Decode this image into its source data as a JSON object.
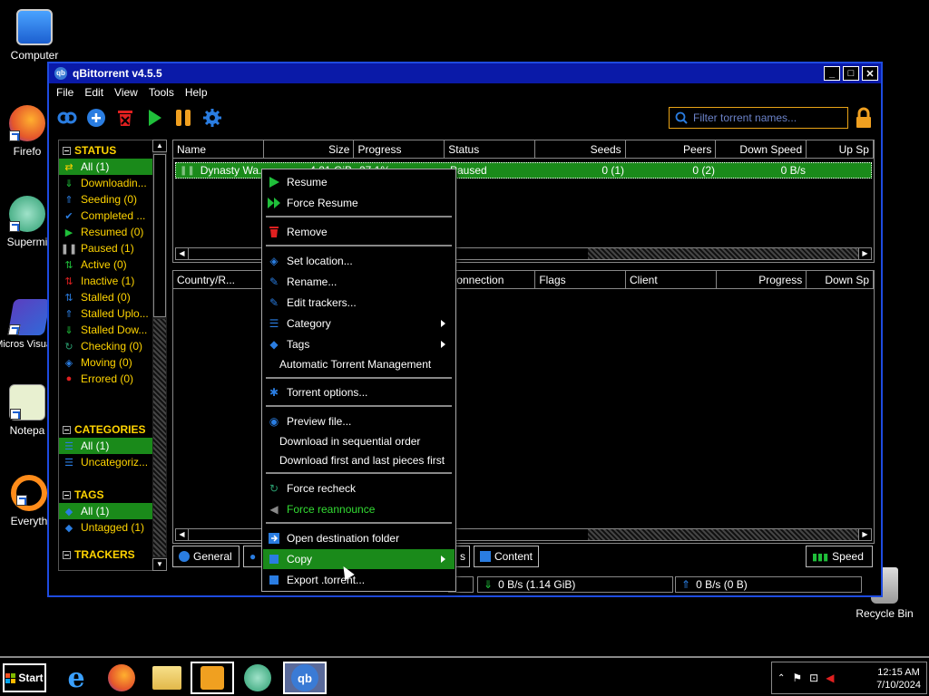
{
  "desktop": {
    "icons": [
      {
        "label": "Computer"
      },
      {
        "label": "Firefo"
      },
      {
        "label": "Supermi"
      },
      {
        "label": "Micros Visual S"
      },
      {
        "label": "Notepa"
      },
      {
        "label": "Everyth"
      },
      {
        "label": "Recycle Bin"
      }
    ]
  },
  "window": {
    "title": "qBittorrent v4.5.5",
    "controls": {
      "minimize": "_",
      "maximize": "□",
      "close": "✕"
    },
    "menu": [
      "File",
      "Edit",
      "View",
      "Tools",
      "Help"
    ],
    "search_placeholder": "Filter torrent names..."
  },
  "sidebar": {
    "status_header": "STATUS",
    "status_items": [
      {
        "label": "All (1)",
        "icon": "shuffle-icon"
      },
      {
        "label": "Downloadin...",
        "icon": "download-icon"
      },
      {
        "label": "Seeding (0)",
        "icon": "upload-icon"
      },
      {
        "label": "Completed ...",
        "icon": "check-icon"
      },
      {
        "label": "Resumed (0)",
        "icon": "play-icon"
      },
      {
        "label": "Paused (1)",
        "icon": "pause-icon"
      },
      {
        "label": "Active (0)",
        "icon": "active-icon"
      },
      {
        "label": "Inactive (1)",
        "icon": "inactive-icon"
      },
      {
        "label": "Stalled (0)",
        "icon": "stalled-icon"
      },
      {
        "label": "Stalled Uplo...",
        "icon": "stalled-up-icon"
      },
      {
        "label": "Stalled Dow...",
        "icon": "stalled-down-icon"
      },
      {
        "label": "Checking (0)",
        "icon": "checking-icon"
      },
      {
        "label": "Moving (0)",
        "icon": "moving-icon"
      },
      {
        "label": "Errored (0)",
        "icon": "error-icon"
      }
    ],
    "categories_header": "CATEGORIES",
    "categories_items": [
      {
        "label": "All (1)"
      },
      {
        "label": "Uncategoriz..."
      }
    ],
    "tags_header": "TAGS",
    "tags_items": [
      {
        "label": "All (1)"
      },
      {
        "label": "Untagged (1)"
      }
    ],
    "trackers_header": "TRACKERS"
  },
  "torrent_list": {
    "columns": [
      "Name",
      "Size",
      "Progress",
      "Status",
      "Seeds",
      "Peers",
      "Down Speed",
      "Up Sp"
    ],
    "rows": [
      {
        "name": "Dynasty Wa...",
        "size": "4.21 GiB",
        "progress": "27.1%",
        "status": "Paused",
        "seeds": "0 (1)",
        "peers": "0 (2)",
        "down_speed": "0 B/s"
      }
    ]
  },
  "peers": {
    "columns": [
      "Country/R...",
      "Connection",
      "Flags",
      "Client",
      "Progress",
      "Down Sp"
    ]
  },
  "bottom_tabs": {
    "general": "General",
    "partial": "s",
    "content": "Content",
    "speed": "Speed"
  },
  "statusbar": {
    "download": "0 B/s (1.14 GiB)",
    "upload": "0 B/s (0 B)"
  },
  "context_menu": {
    "items": [
      {
        "label": "Resume"
      },
      {
        "label": "Force Resume"
      },
      {
        "label": "Remove"
      },
      {
        "label": "Set location..."
      },
      {
        "label": "Rename..."
      },
      {
        "label": "Edit trackers..."
      },
      {
        "label": "Category"
      },
      {
        "label": "Tags"
      },
      {
        "label": "Automatic Torrent Management"
      },
      {
        "label": "Torrent options..."
      },
      {
        "label": "Preview file..."
      },
      {
        "label": "Download in sequential order"
      },
      {
        "label": "Download first and last pieces first"
      },
      {
        "label": "Force recheck"
      },
      {
        "label": "Force reannounce"
      },
      {
        "label": "Open destination folder"
      },
      {
        "label": "Copy"
      },
      {
        "label": "Export .torrent..."
      }
    ]
  },
  "taskbar": {
    "start_label": "Start",
    "time": "12:15 AM",
    "date": "7/10/2024"
  },
  "colors": {
    "accent_green": "#1a8a1a",
    "title_blue": "#0a1aa8",
    "status_yellow": "#ffd400",
    "border_blue": "#1e4be0"
  }
}
